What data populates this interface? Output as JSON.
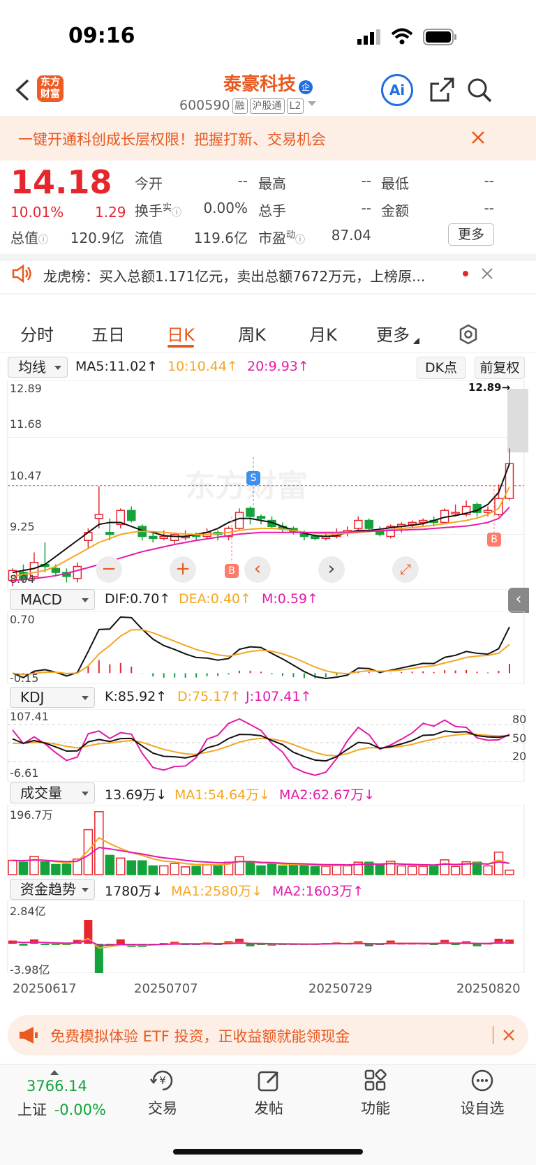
{
  "status": {
    "time": "09:16"
  },
  "header": {
    "logo": "东方\n财富",
    "name": "泰豪科技",
    "badge": "企",
    "code": "600590",
    "tags": [
      "融",
      "沪股通",
      "L2"
    ],
    "ai_label": "Ai"
  },
  "banner": {
    "text": "一键开通科创成长层权限！把握打新、交易机会"
  },
  "quote": {
    "price": "14.18",
    "pct": "10.01%",
    "chg": "1.29",
    "row1": [
      {
        "label": "今开",
        "value": "--"
      },
      {
        "label": "最高",
        "value": "--"
      },
      {
        "label": "最低",
        "value": "--"
      }
    ],
    "row2": [
      {
        "label": "换手",
        "sup": "实",
        "value": "0.00%"
      },
      {
        "label": "总手",
        "value": "--"
      },
      {
        "label": "金额",
        "value": "--"
      }
    ],
    "row3": [
      {
        "label": "总值",
        "value": "120.9亿"
      },
      {
        "label": "流值",
        "value": "119.6亿"
      },
      {
        "label": "市盈",
        "sup": "动",
        "value": "87.04"
      }
    ],
    "more": "更多"
  },
  "notice": {
    "text": "龙虎榜：买入总额1.171亿元，卖出总额7672万元，上榜原..."
  },
  "tabs": [
    "分时",
    "五日",
    "日K",
    "周K",
    "月K",
    "更多"
  ],
  "active_tab": "日K",
  "kline": {
    "indicator": "均线",
    "ma5": "MA5:11.02↑",
    "ma10": "10:10.44↑",
    "ma20": "20:9.93↑",
    "dk": "DK点",
    "fq": "前复权",
    "y_labels": [
      "12.89",
      "11.68",
      "10.47",
      "9.25",
      "8.04"
    ],
    "max_label": "12.89→",
    "watermark": "东方财富",
    "buy_mark": "B",
    "sell_mark": "S"
  },
  "macd": {
    "name": "MACD",
    "dif": "DIF:0.70↑",
    "dea": "DEA:0.40↑",
    "m": "M:0.59↑",
    "top": "0.70",
    "bottom": "-0.15"
  },
  "kdj": {
    "name": "KDJ",
    "k": "K:85.92↑",
    "d": "D:75.17↑",
    "j": "J:107.41↑",
    "top": "107.41",
    "bottom": "-6.61",
    "levels": [
      "80",
      "50",
      "20"
    ]
  },
  "volume": {
    "name": "成交量",
    "cur": "13.69万↓",
    "ma1": "MA1:54.64万↓",
    "ma2": "MA2:62.67万↓",
    "top": "196.7万"
  },
  "fund": {
    "name": "资金趋势",
    "cur": "1780万↓",
    "ma1": "MA1:2580万↓",
    "ma2": "MA2:1603万↑",
    "top": "2.84亿",
    "bottom": "-3.98亿"
  },
  "dates": [
    "20250617",
    "20250707",
    "20250729",
    "20250820"
  ],
  "promo": {
    "text": "免费模拟体验 ETF 投资，正收益额就能领现金"
  },
  "bottom_nav": {
    "index_value": "3766.14",
    "index_name": "上证",
    "index_chg": "-0.00%",
    "items": [
      "交易",
      "发帖",
      "功能",
      "设自选"
    ]
  },
  "colors": {
    "up": "#e5262d",
    "down": "#13a33a",
    "accent": "#e85a20",
    "ma10": "#f5a623",
    "ma20": "#e31ba8",
    "ai_blue": "#1f6fe0"
  },
  "chart_data": {
    "type": "candlestick",
    "y_range": [
      8.04,
      12.89
    ],
    "candles": [
      [
        8.1,
        8.35,
        7.95,
        8.4
      ],
      [
        8.3,
        8.15,
        8.05,
        8.5
      ],
      [
        8.2,
        8.55,
        8.1,
        8.8
      ],
      [
        8.5,
        8.45,
        8.3,
        9.05
      ],
      [
        8.4,
        8.3,
        8.2,
        8.5
      ],
      [
        8.3,
        8.2,
        8.05,
        8.4
      ],
      [
        8.15,
        8.45,
        8.05,
        8.55
      ],
      [
        9.1,
        9.3,
        8.9,
        9.4
      ],
      [
        9.65,
        9.75,
        9.4,
        10.45
      ],
      [
        9.3,
        9.25,
        9.1,
        9.65
      ],
      [
        9.5,
        9.85,
        9.4,
        9.9
      ],
      [
        9.85,
        9.6,
        9.55,
        9.95
      ],
      [
        9.45,
        9.2,
        9.1,
        9.5
      ],
      [
        9.2,
        9.15,
        9.05,
        9.3
      ],
      [
        9.15,
        9.2,
        9.1,
        9.35
      ],
      [
        9.1,
        9.25,
        9.0,
        9.3
      ],
      [
        9.2,
        9.2,
        9.1,
        9.35
      ],
      [
        9.25,
        9.2,
        9.1,
        9.3
      ],
      [
        9.2,
        9.3,
        9.15,
        9.4
      ],
      [
        9.3,
        9.25,
        9.1,
        9.35
      ],
      [
        9.2,
        9.4,
        9.1,
        9.45
      ],
      [
        9.4,
        9.8,
        9.35,
        9.9
      ],
      [
        9.9,
        9.7,
        9.5,
        9.95
      ],
      [
        9.7,
        9.65,
        9.5,
        9.75
      ],
      [
        9.6,
        9.45,
        9.4,
        9.7
      ],
      [
        9.45,
        9.4,
        9.3,
        9.55
      ],
      [
        9.4,
        9.3,
        9.25,
        9.45
      ],
      [
        9.3,
        9.2,
        9.1,
        9.35
      ],
      [
        9.2,
        9.15,
        9.1,
        9.25
      ],
      [
        9.15,
        9.2,
        9.1,
        9.3
      ],
      [
        9.2,
        9.3,
        9.15,
        9.4
      ],
      [
        9.3,
        9.35,
        9.2,
        9.45
      ],
      [
        9.4,
        9.6,
        9.35,
        9.7
      ],
      [
        9.6,
        9.4,
        9.3,
        9.65
      ],
      [
        9.35,
        9.25,
        9.2,
        9.45
      ],
      [
        9.2,
        9.45,
        9.15,
        9.5
      ],
      [
        9.45,
        9.5,
        9.3,
        9.55
      ],
      [
        9.5,
        9.55,
        9.4,
        9.6
      ],
      [
        9.55,
        9.6,
        9.45,
        9.65
      ],
      [
        9.6,
        9.55,
        9.45,
        9.7
      ],
      [
        9.55,
        9.85,
        9.5,
        9.9
      ],
      [
        9.8,
        9.8,
        9.7,
        10.0
      ],
      [
        9.75,
        9.95,
        9.7,
        10.1
      ],
      [
        10.0,
        9.8,
        9.7,
        10.05
      ],
      [
        9.8,
        9.85,
        9.7,
        9.95
      ],
      [
        9.75,
        10.15,
        9.7,
        10.5
      ],
      [
        10.15,
        11.02,
        10.1,
        11.4
      ]
    ],
    "ma5": [
      8.3,
      8.35,
      8.4,
      8.5,
      8.7,
      8.9,
      9.1,
      9.3,
      9.5,
      9.55,
      9.55,
      9.45,
      9.35,
      9.3,
      9.22,
      9.2,
      9.2,
      9.25,
      9.3,
      9.4,
      9.55,
      9.65,
      9.65,
      9.6,
      9.55,
      9.45,
      9.35,
      9.28,
      9.22,
      9.2,
      9.22,
      9.3,
      9.35,
      9.35,
      9.38,
      9.42,
      9.45,
      9.48,
      9.52,
      9.6,
      9.68,
      9.72,
      9.78,
      9.85,
      10.0,
      10.3,
      11.02
    ],
    "ma10": [
      8.2,
      8.25,
      8.3,
      8.35,
      8.45,
      8.6,
      8.75,
      8.9,
      9.05,
      9.15,
      9.25,
      9.3,
      9.33,
      9.32,
      9.3,
      9.28,
      9.26,
      9.25,
      9.25,
      9.27,
      9.3,
      9.35,
      9.38,
      9.4,
      9.4,
      9.38,
      9.35,
      9.3,
      9.28,
      9.27,
      9.26,
      9.28,
      9.3,
      9.32,
      9.35,
      9.37,
      9.4,
      9.42,
      9.45,
      9.48,
      9.52,
      9.56,
      9.6,
      9.66,
      9.75,
      9.9,
      10.44
    ],
    "ma20": [
      8.1,
      8.12,
      8.15,
      8.18,
      8.22,
      8.28,
      8.35,
      8.42,
      8.5,
      8.58,
      8.66,
      8.74,
      8.82,
      8.88,
      8.94,
      9.0,
      9.05,
      9.1,
      9.14,
      9.18,
      9.22,
      9.26,
      9.28,
      9.3,
      9.3,
      9.3,
      9.3,
      9.3,
      9.3,
      9.3,
      9.3,
      9.31,
      9.32,
      9.33,
      9.34,
      9.35,
      9.36,
      9.37,
      9.38,
      9.4,
      9.42,
      9.44,
      9.46,
      9.5,
      9.55,
      9.65,
      9.93
    ]
  }
}
